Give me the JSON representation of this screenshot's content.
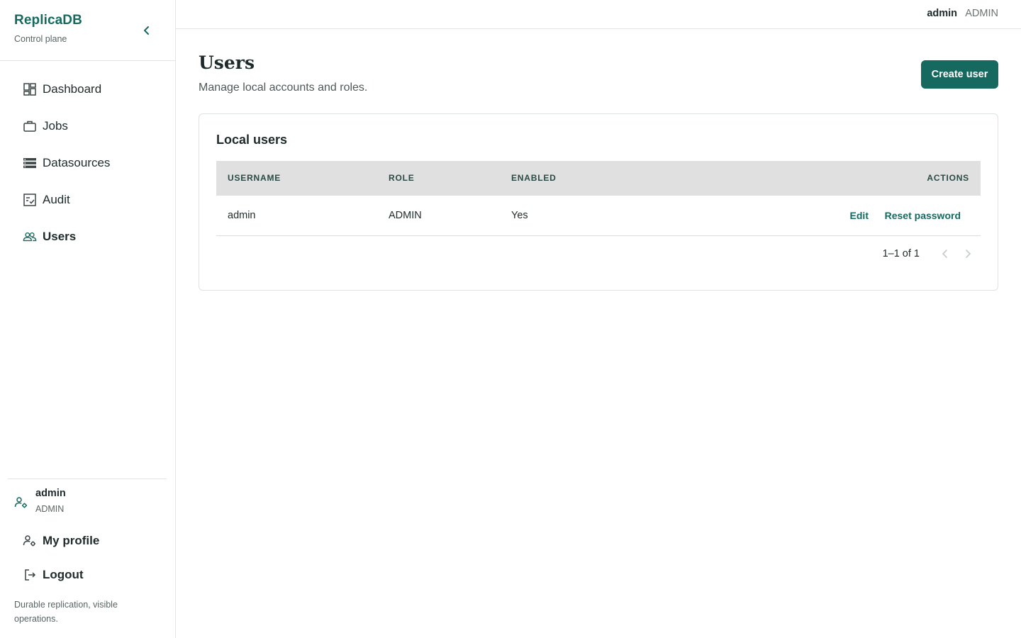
{
  "app": {
    "brand": "ReplicaDB",
    "subtitle": "Control plane"
  },
  "sidebar": {
    "items": [
      {
        "label": "Dashboard",
        "icon": "dashboard-icon"
      },
      {
        "label": "Jobs",
        "icon": "briefcase-icon"
      },
      {
        "label": "Datasources",
        "icon": "storage-icon"
      },
      {
        "label": "Audit",
        "icon": "checklist-icon"
      },
      {
        "label": "Users",
        "icon": "users-icon",
        "active": true
      }
    ],
    "user": {
      "name": "admin",
      "role": "ADMIN"
    },
    "profile_label": "My profile",
    "logout_label": "Logout",
    "tagline": "Durable replication, visible operations."
  },
  "topbar": {
    "username": "admin",
    "role": "ADMIN"
  },
  "page": {
    "title": "Users",
    "subtitle": "Manage local accounts and roles.",
    "create_label": "Create user"
  },
  "card": {
    "title": "Local users",
    "columns": [
      "USERNAME",
      "ROLE",
      "ENABLED",
      "ACTIONS"
    ],
    "rows": [
      {
        "username": "admin",
        "role": "ADMIN",
        "enabled": "Yes",
        "edit": "Edit",
        "reset": "Reset password"
      }
    ],
    "pagination": "1–1 of 1"
  },
  "colors": {
    "accent": "#15695e",
    "header_bg": "#e0e0e0"
  }
}
